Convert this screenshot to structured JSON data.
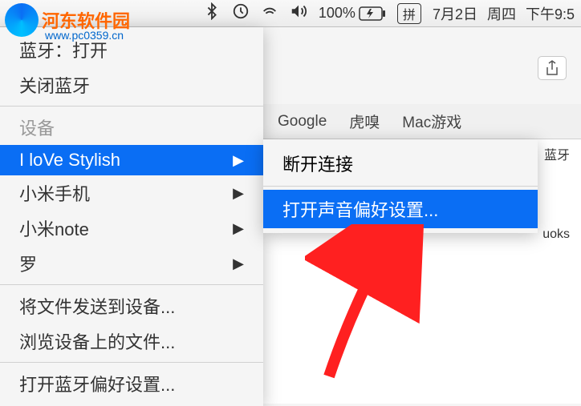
{
  "watermark": {
    "site_name": "河东软件园",
    "url": "www.pc0359.cn"
  },
  "menubar": {
    "battery_percent": "100%",
    "input_method": "拼",
    "date": "7月2日",
    "weekday": "周四",
    "time": "下午9:5"
  },
  "bluetooth_menu": {
    "status": "蓝牙：打开",
    "toggle_off": "关闭蓝牙",
    "devices_header": "设备",
    "devices": [
      {
        "name": "I loVe Stylish",
        "selected": true,
        "has_submenu": true
      },
      {
        "name": "小米手机",
        "selected": false,
        "has_submenu": true
      },
      {
        "name": "小米note",
        "selected": false,
        "has_submenu": true
      },
      {
        "name": "罗",
        "selected": false,
        "has_submenu": true
      }
    ],
    "send_file": "将文件发送到设备...",
    "browse_files": "浏览设备上的文件...",
    "open_prefs": "打开蓝牙偏好设置..."
  },
  "submenu": {
    "disconnect": "断开连接",
    "sound_prefs": "打开声音偏好设置..."
  },
  "bookmarks": {
    "items": [
      "Google",
      "虎嗅",
      "Mac游戏"
    ]
  },
  "content": {
    "text1": "蓝牙",
    "text2": "uoks"
  }
}
